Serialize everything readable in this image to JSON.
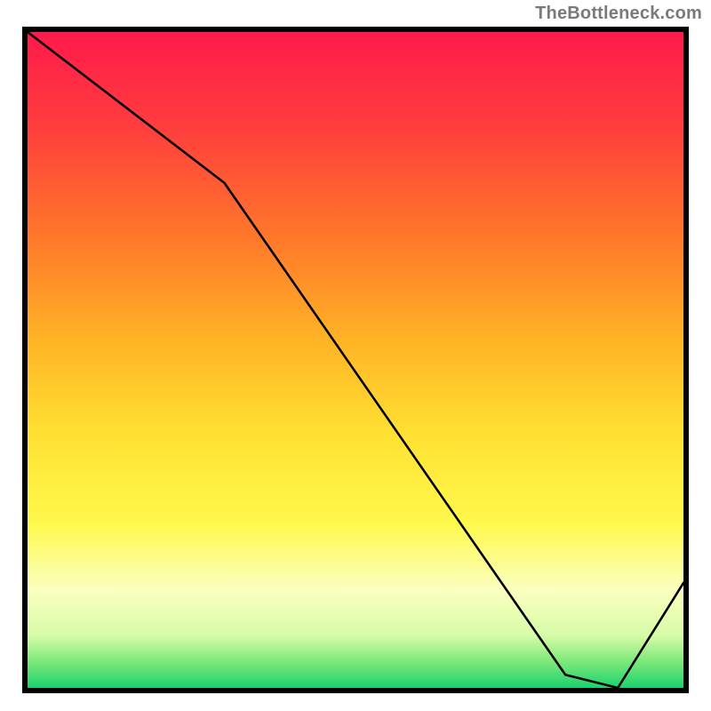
{
  "watermark": "TheBottleneck.com",
  "chart_data": {
    "type": "line",
    "x": [
      0.0,
      0.3,
      0.82,
      0.9,
      1.0
    ],
    "values": [
      1.0,
      0.77,
      0.02,
      0.0,
      0.16
    ],
    "xlim": [
      0,
      1
    ],
    "ylim": [
      0,
      1
    ],
    "title": "",
    "xlabel": "",
    "ylabel": "",
    "series": [
      {
        "name": "curve",
        "x": [
          0.0,
          0.3,
          0.82,
          0.9,
          1.0
        ],
        "y": [
          1.0,
          0.77,
          0.02,
          0.0,
          0.16
        ]
      }
    ],
    "marker_text": "",
    "marker_x": 0.83,
    "marker_y": 0.01
  },
  "colors": {
    "border": "#000000",
    "line": "#000000",
    "gradient_top": "#ff1a4b",
    "gradient_bottom": "#19d36e",
    "watermark": "#7a7a7a"
  }
}
